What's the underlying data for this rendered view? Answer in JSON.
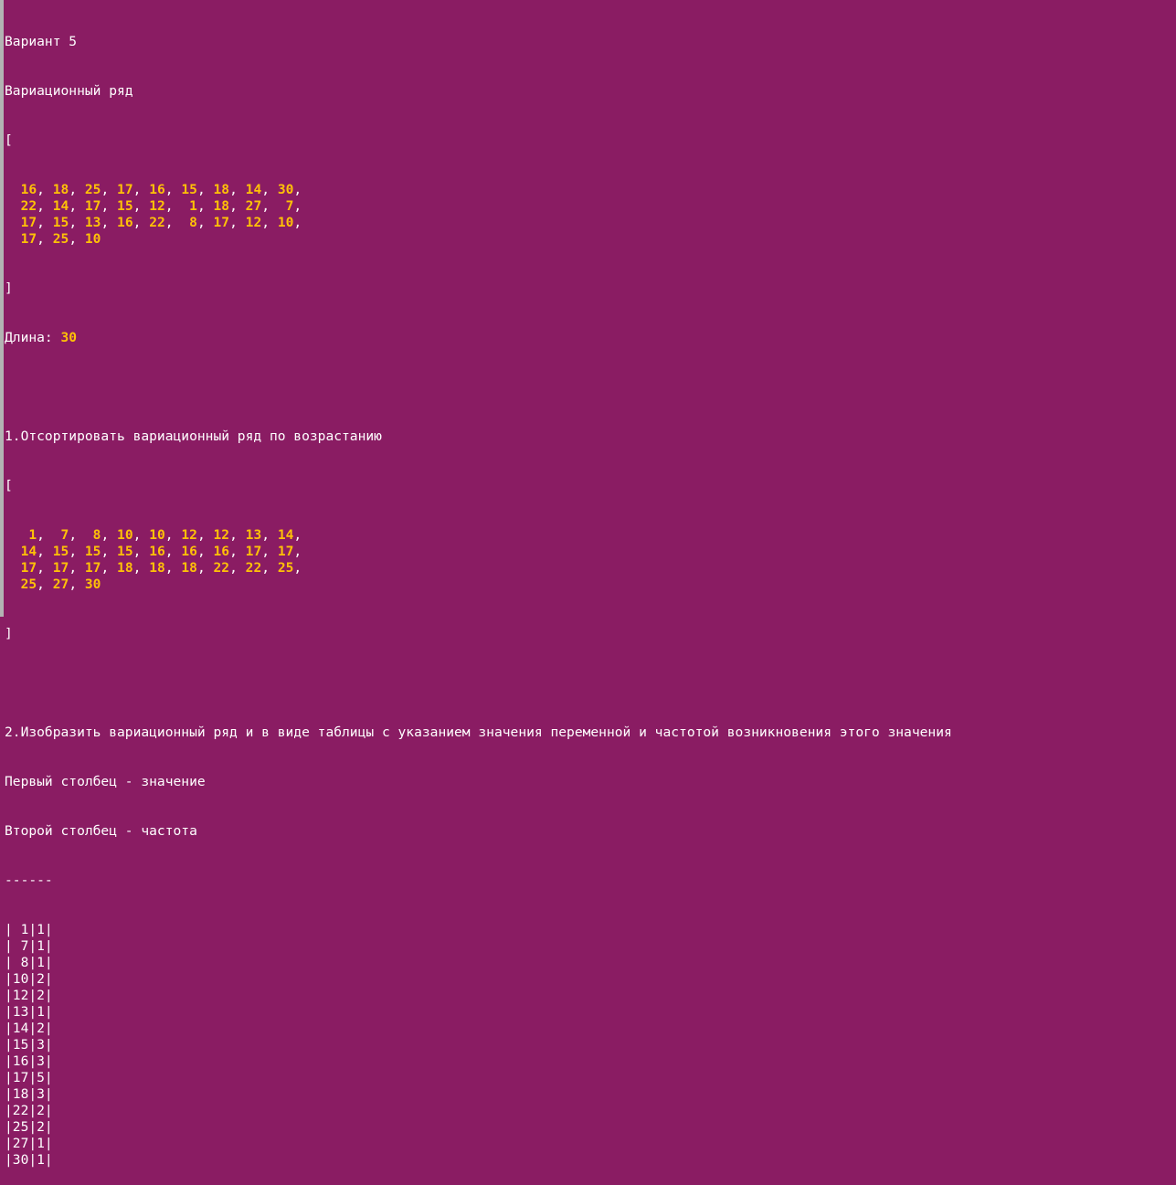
{
  "header": {
    "variant": "Вариант 5",
    "series_title": "Вариационный ряд"
  },
  "raw_series": {
    "open": "[",
    "close": "]",
    "rows": [
      [
        "16",
        "18",
        "25",
        "17",
        "16",
        "15",
        "18",
        "14",
        "30"
      ],
      [
        "22",
        "14",
        "17",
        "15",
        "12",
        " 1",
        "18",
        "27",
        " 7"
      ],
      [
        "17",
        "15",
        "13",
        "16",
        "22",
        " 8",
        "17",
        "12",
        "10"
      ],
      [
        "17",
        "25",
        "10"
      ]
    ],
    "length_label": "Длина: ",
    "length_value": "30"
  },
  "task1": {
    "title": "1.Отсортировать вариационный ряд по возрастанию",
    "open": "[",
    "close": "]",
    "rows": [
      [
        " 1",
        " 7",
        " 8",
        "10",
        "10",
        "12",
        "12",
        "13",
        "14"
      ],
      [
        "14",
        "15",
        "15",
        "15",
        "16",
        "16",
        "16",
        "17",
        "17"
      ],
      [
        "17",
        "17",
        "17",
        "18",
        "18",
        "18",
        "22",
        "22",
        "25"
      ],
      [
        "25",
        "27",
        "30"
      ]
    ]
  },
  "task2": {
    "title": "2.Изобразить вариационный ряд и в виде таблицы с указанием значения переменной и частотой возникновения этого значения",
    "col1_desc": "Первый столбец - значение",
    "col2_desc": "Второй столбец - частота",
    "divider": "------",
    "table": [
      "| 1|1|",
      "| 7|1|",
      "| 8|1|",
      "|10|2|",
      "|12|2|",
      "|13|1|",
      "|14|2|",
      "|15|3|",
      "|16|3|",
      "|17|5|",
      "|18|3|",
      "|22|2|",
      "|25|2|",
      "|27|1|",
      "|30|1|"
    ]
  }
}
